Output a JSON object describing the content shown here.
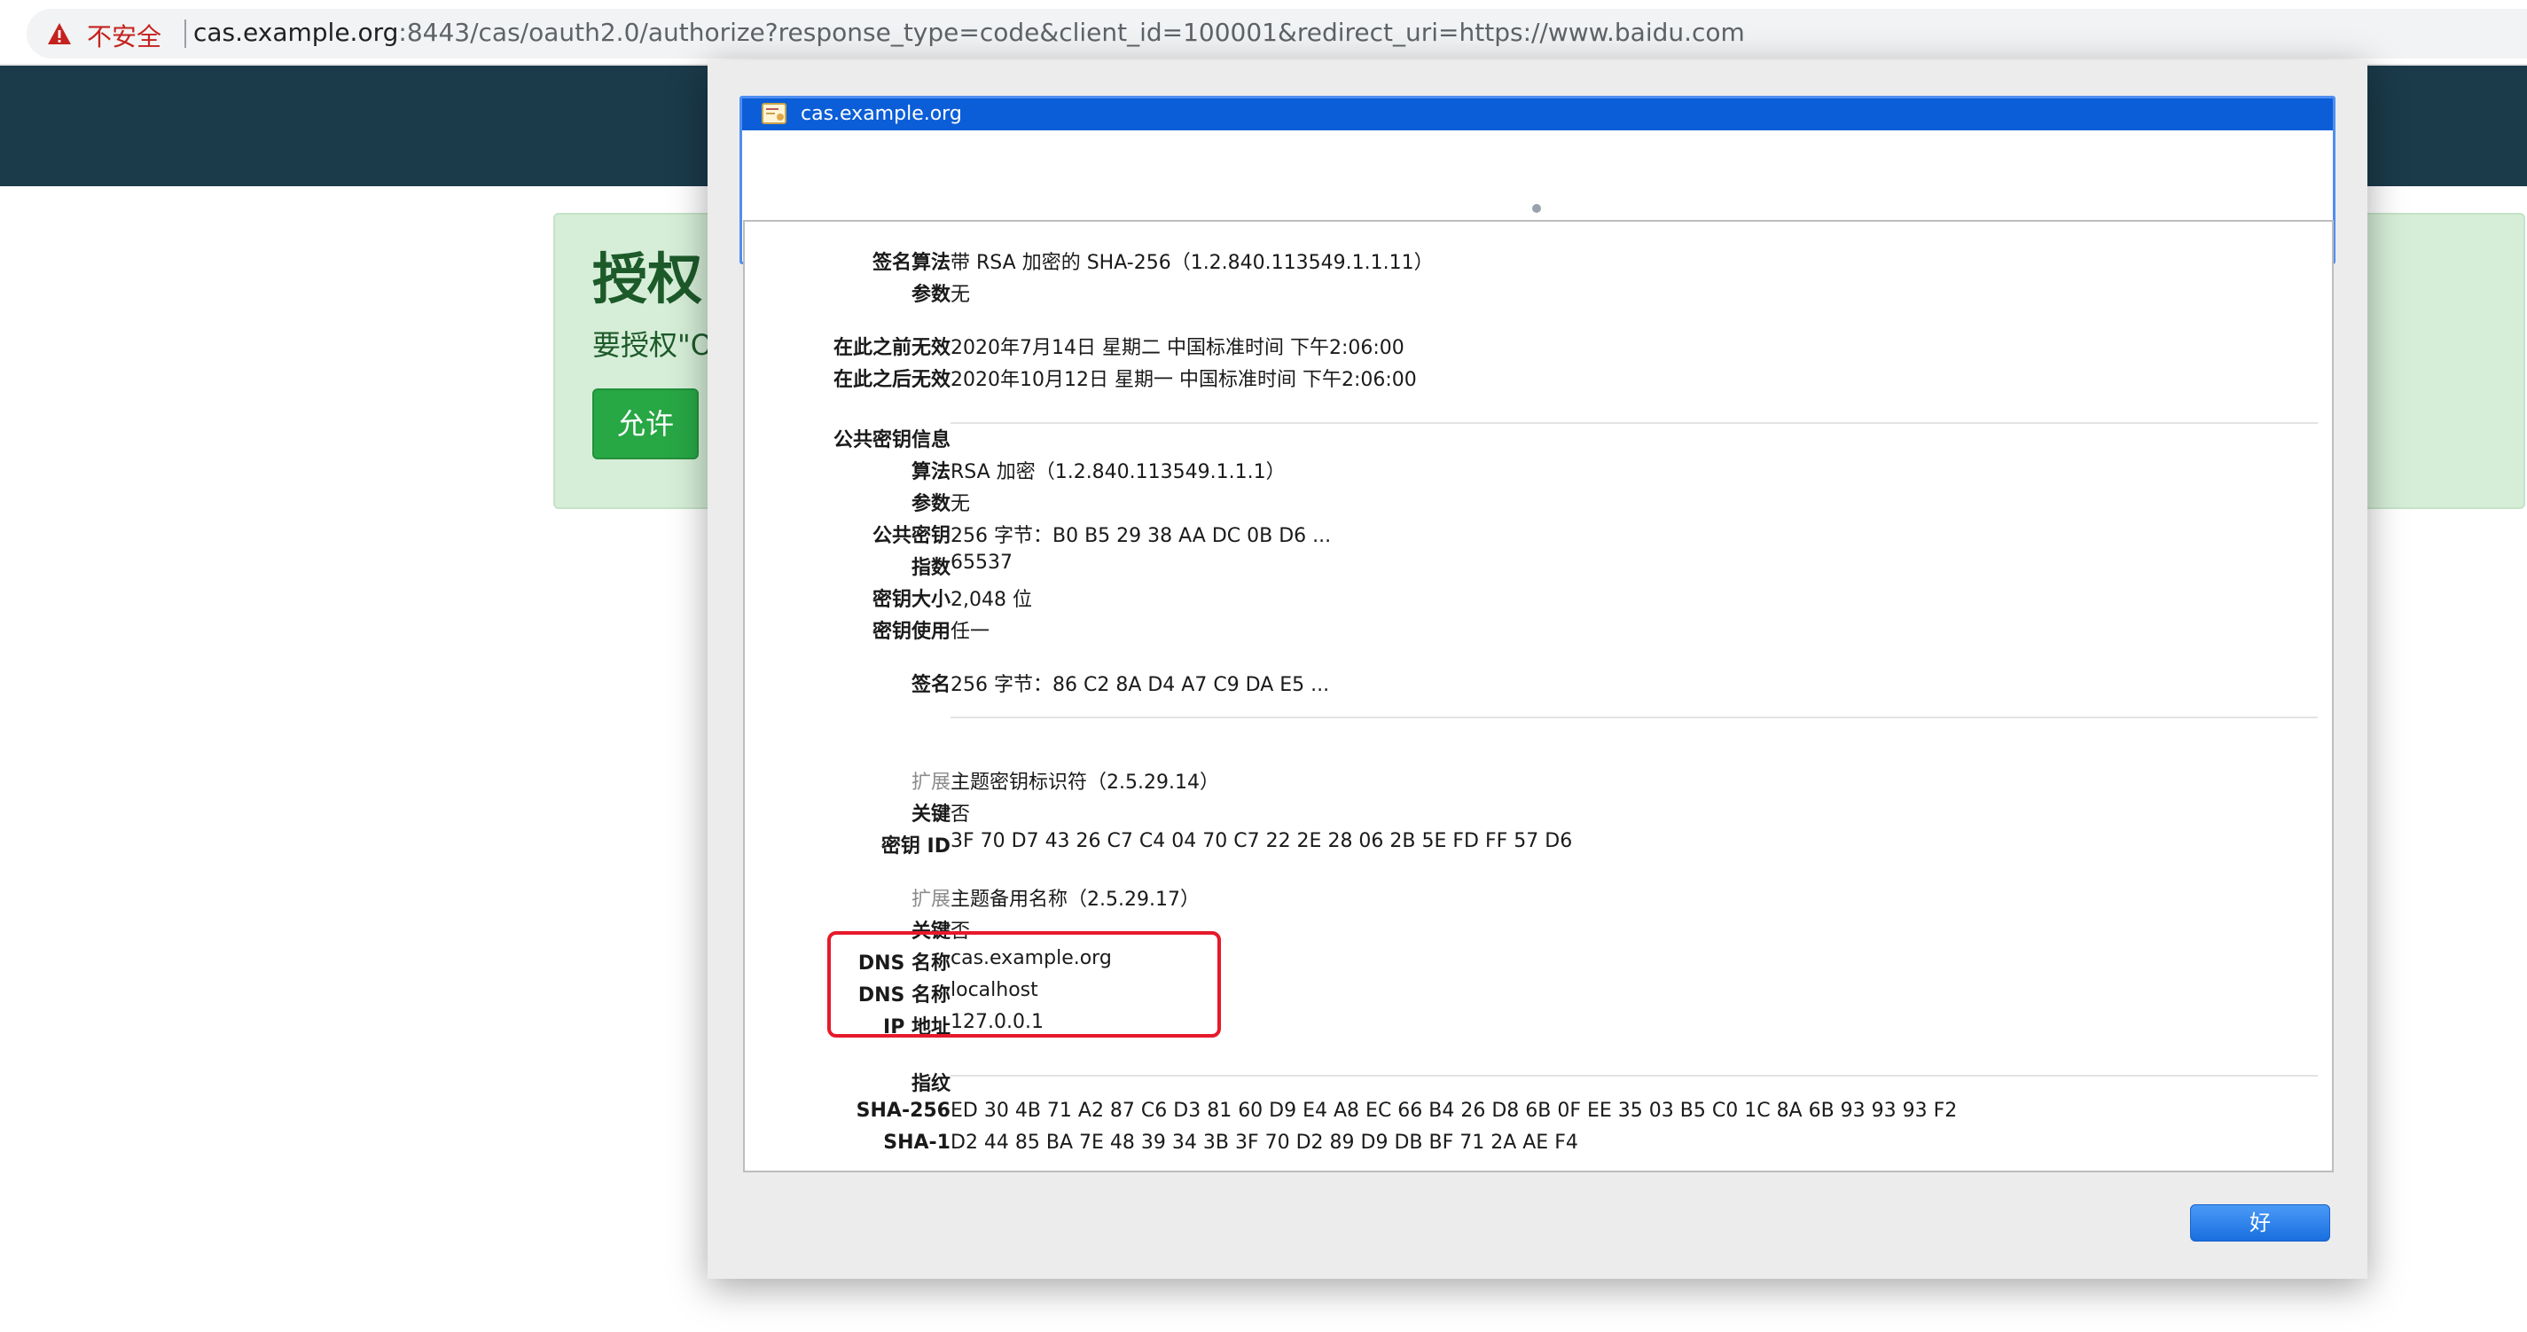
{
  "browser": {
    "security_label": "不安全",
    "url_host": "cas.example.org",
    "url_rest": ":8443/cas/oauth2.0/authorize?response_type=code&client_id=100001&redirect_uri=https://www.baidu.com"
  },
  "page": {
    "brand_fragment": "",
    "auth_title": "授权",
    "auth_desc": "要授权\"O",
    "allow_label": "允许"
  },
  "dialog": {
    "cert_list": [
      {
        "name": "cas.example.org",
        "selected": true
      }
    ],
    "fields": [
      {
        "label": "签名算法",
        "value": "带 RSA 加密的 SHA-256（1.2.840.113549.1.1.11）",
        "bold": true
      },
      {
        "label": "参数",
        "value": "无",
        "bold": true
      },
      {
        "label": "在此之前无效",
        "value": "2020年7月14日 星期二 中国标准时间 下午2:06:00",
        "bold": true
      },
      {
        "label": "在此之后无效",
        "value": "2020年10月12日 星期一 中国标准时间 下午2:06:00",
        "bold": true
      },
      {
        "label": "公共密钥信息",
        "value": "",
        "bold": true
      },
      {
        "label": "算法",
        "value": "RSA 加密（1.2.840.113549.1.1.1）",
        "bold": true
      },
      {
        "label": "参数",
        "value": "无",
        "bold": true
      },
      {
        "label": "公共密钥",
        "value": "256 字节：B0 B5 29 38 AA DC 0B D6 ...",
        "bold": true
      },
      {
        "label": "指数",
        "value": "65537",
        "bold": true
      },
      {
        "label": "密钥大小",
        "value": "2,048 位",
        "bold": true
      },
      {
        "label": "密钥使用",
        "value": "任一",
        "bold": true
      },
      {
        "label": "签名",
        "value": "256 字节：86 C2 8A D4 A7 C9 DA E5 ...",
        "bold": true
      },
      {
        "label": "扩展",
        "value": "主题密钥标识符（2.5.29.14）",
        "bold": false
      },
      {
        "label": "关键",
        "value": "否",
        "bold": true
      },
      {
        "label": "密钥 ID",
        "value": "3F 70 D7 43 26 C7 C4 04 70 C7 22 2E 28 06 2B 5E FD FF 57 D6",
        "bold": true
      },
      {
        "label": "扩展",
        "value": "主题备用名称（2.5.29.17）",
        "bold": false
      },
      {
        "label": "关键",
        "value": "否",
        "bold": true
      },
      {
        "label": "DNS 名称",
        "value": "cas.example.org",
        "bold": true
      },
      {
        "label": "DNS 名称",
        "value": "localhost",
        "bold": true
      },
      {
        "label": "IP 地址",
        "value": "127.0.0.1",
        "bold": true
      },
      {
        "label": "指纹",
        "value": "",
        "bold": true
      },
      {
        "label": "SHA-256",
        "value": "ED 30 4B 71 A2 87 C6 D3 81 60 D9 E4 A8 EC 66 B4 26 D8 6B 0F EE 35 03 B5 C0 1C 8A 6B 93 93 93 F2",
        "bold": true
      },
      {
        "label": "SHA-1",
        "value": "D2 44 85 BA 7E 48 39 34 3B 3F 70 D2 89 D9 DB BF 71 2A AE F4",
        "bold": true
      }
    ],
    "ok_label": "好"
  },
  "colors": {
    "header": "#1b3a4a",
    "panel": "#d6eed8",
    "allow_button": "#28a745",
    "selection": "#0b5ed7",
    "highlight": "#e6192b",
    "ok_button": "#1a6fe0"
  }
}
